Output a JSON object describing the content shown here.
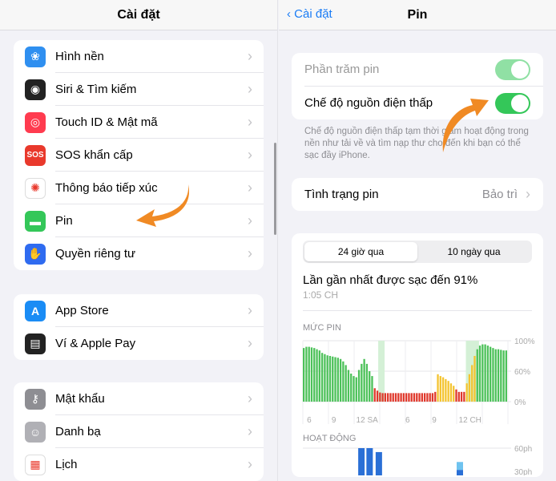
{
  "left": {
    "title": "Cài đặt",
    "groups": [
      [
        {
          "label": "Hình nền",
          "icon": "flower-icon",
          "color": "#2f8ff0"
        },
        {
          "label": "Siri & Tìm kiếm",
          "icon": "siri-icon",
          "color": "#222"
        },
        {
          "label": "Touch ID & Mật mã",
          "icon": "fingerprint-icon",
          "color": "#ff3b4f"
        },
        {
          "label": "SOS khẩn cấp",
          "icon": "sos-icon",
          "color": "#e9392c"
        },
        {
          "label": "Thông báo tiếp xúc",
          "icon": "exposure-icon",
          "color": "#fff"
        },
        {
          "label": "Pin",
          "icon": "battery-icon",
          "color": "#34c759"
        },
        {
          "label": "Quyền riêng tư",
          "icon": "hand-icon",
          "color": "#2f6bf0"
        }
      ],
      [
        {
          "label": "App Store",
          "icon": "app-store-icon",
          "color": "#1a8cf5"
        },
        {
          "label": "Ví & Apple Pay",
          "icon": "wallet-icon",
          "color": "#222"
        }
      ],
      [
        {
          "label": "Mật khẩu",
          "icon": "key-icon",
          "color": "#8e8e93"
        },
        {
          "label": "Danh bạ",
          "icon": "contacts-icon",
          "color": "#b0b0b5"
        },
        {
          "label": "Lịch",
          "icon": "calendar-icon",
          "color": "#fff"
        }
      ]
    ]
  },
  "right": {
    "back": "Cài đặt",
    "title": "Pin",
    "battery_percentage": {
      "label": "Phần trăm pin",
      "on": true
    },
    "low_power": {
      "label": "Chế độ nguồn điện thấp",
      "on": true
    },
    "note": "Chế độ nguồn điện thấp tạm thời giảm hoạt động trong nền như tải về và tìm nạp thư cho đến khi bạn có thể sạc đầy iPhone.",
    "health": {
      "label": "Tình trạng pin",
      "value": "Bảo trì"
    },
    "tabs": [
      "24 giờ qua",
      "10 ngày qua"
    ],
    "last_charge": "Lần gần nhất được sạc đến 91%",
    "last_charge_time": "1:05 CH",
    "level_title": "MỨC PIN",
    "activity_title": "HOẠT ĐỘNG"
  },
  "chart_data": [
    {
      "type": "bar",
      "title": "MỨC PIN",
      "yticks": [
        "100%",
        "60%",
        "0%"
      ],
      "xticks": [
        "6",
        "9",
        "12 SA",
        "6",
        "9",
        "12 CH"
      ],
      "ylim": [
        0,
        100
      ],
      "colors": {
        "normal": "#4cc159",
        "low": "#e0392c",
        "low_power": "#f4c430",
        "charging_bg": "#d4f0d6"
      },
      "values": [
        88,
        90,
        90,
        89,
        88,
        86,
        84,
        80,
        78,
        76,
        75,
        74,
        73,
        72,
        70,
        66,
        60,
        52,
        46,
        42,
        40,
        52,
        62,
        70,
        62,
        50,
        42,
        22,
        18,
        15,
        14,
        14,
        14,
        14,
        14,
        14,
        14,
        14,
        14,
        14,
        14,
        14,
        14,
        14,
        14,
        14,
        14,
        14,
        14,
        14,
        16,
        45,
        42,
        40,
        37,
        34,
        30,
        26,
        20,
        16,
        16,
        16,
        30,
        45,
        60,
        75,
        86,
        92,
        94,
        94,
        92,
        90,
        88,
        86,
        86,
        85,
        84,
        84
      ],
      "status": [
        "g",
        "g",
        "g",
        "g",
        "g",
        "g",
        "g",
        "g",
        "g",
        "g",
        "g",
        "g",
        "g",
        "g",
        "g",
        "g",
        "g",
        "g",
        "g",
        "g",
        "g",
        "g",
        "g",
        "g",
        "g",
        "g",
        "g",
        "r",
        "r",
        "r",
        "r",
        "r",
        "r",
        "r",
        "r",
        "r",
        "r",
        "r",
        "r",
        "r",
        "r",
        "r",
        "r",
        "r",
        "r",
        "r",
        "r",
        "r",
        "r",
        "r",
        "r",
        "y",
        "y",
        "y",
        "y",
        "y",
        "y",
        "y",
        "r",
        "r",
        "r",
        "r",
        "y",
        "y",
        "y",
        "y",
        "g",
        "g",
        "g",
        "g",
        "g",
        "g",
        "g",
        "g",
        "g",
        "g",
        "g",
        "g"
      ]
    },
    {
      "type": "bar",
      "title": "HOẠT ĐỘNG",
      "yticks": [
        "60ph",
        "30ph"
      ],
      "ylim": [
        0,
        60
      ],
      "colors": {
        "screen_on": "#2a6fd6",
        "screen_off": "#6fc3ef"
      },
      "bars": [
        {
          "pos": 0.27,
          "on": 60,
          "off": 0
        },
        {
          "pos": 0.31,
          "on": 60,
          "off": 0
        },
        {
          "pos": 0.355,
          "on": 56,
          "off": 0
        },
        {
          "pos": 0.75,
          "on": 38,
          "off": 8
        }
      ]
    }
  ]
}
